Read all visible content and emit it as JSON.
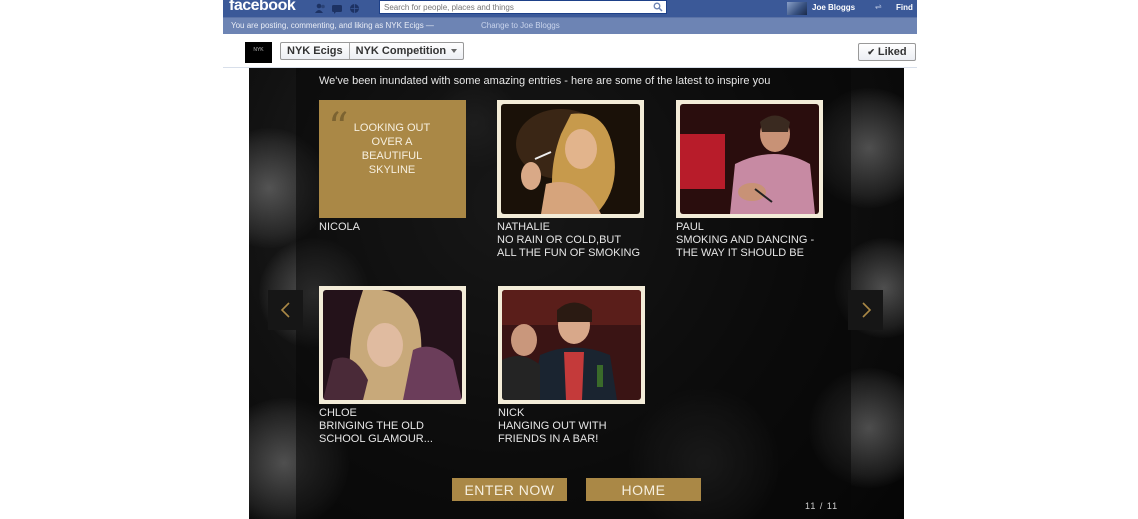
{
  "topbar": {
    "logo": "facebook",
    "search": {
      "placeholder": "Search for people, places and things"
    },
    "user_name": "Joe Bloggs",
    "find_label": "Find"
  },
  "posting_as": {
    "text": "You are posting, commenting, and liking as NYK Ecigs —",
    "change_link": "Change to Joe Bloggs"
  },
  "page_header": {
    "logo_text": "NYK",
    "breadcrumb": [
      "NYK Ecigs",
      "NYK Competition"
    ],
    "liked_label": "Liked"
  },
  "app": {
    "intro": "We've been inundated with some amazing entries - here are some of the latest to inspire you",
    "entries": [
      {
        "name": "NICOLA",
        "quote": "LOOKING OUT OVER A BEAUTIFUL SKYLINE",
        "desc": ""
      },
      {
        "name": "NATHALIE",
        "desc": "NO RAIN OR COLD,BUT\nALL THE FUN OF SMOKING"
      },
      {
        "name": "PAUL",
        "desc": "SMOKING AND DANCING -\nTHE WAY IT SHOULD BE"
      },
      {
        "name": "CHLOE",
        "desc": "BRINGING THE OLD\nSCHOOL GLAMOUR..."
      },
      {
        "name": "NICK",
        "desc": "HANGING OUT WITH\nFRIENDS IN A BAR!"
      }
    ],
    "enter_label": "ENTER NOW",
    "home_label": "HOME",
    "page_count": "11 / 11"
  },
  "colors": {
    "fb_blue": "#3b5998",
    "gold": "#aa8846",
    "cream": "#f3ecd8"
  }
}
